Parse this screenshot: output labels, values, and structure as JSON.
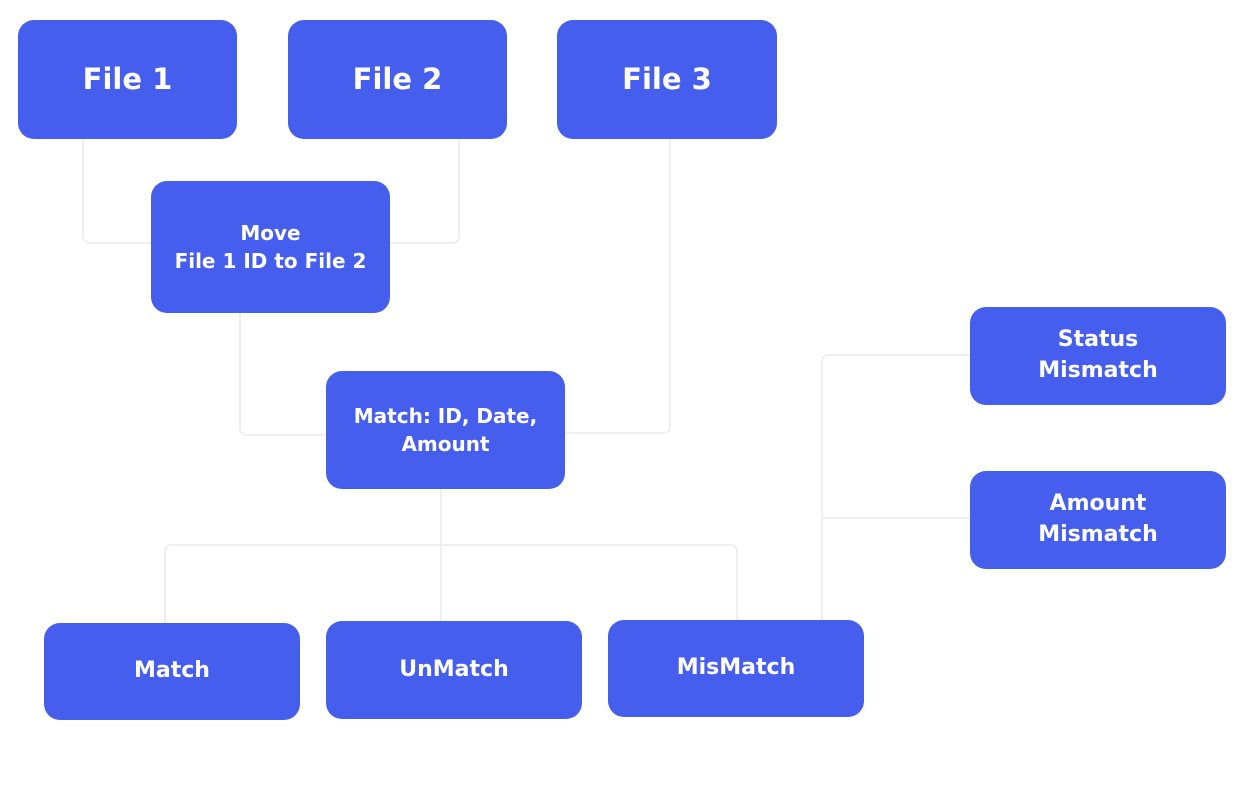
{
  "diagram": {
    "nodes": {
      "file1": "File 1",
      "file2": "File 2",
      "file3": "File 3",
      "move": "Move\nFile 1 ID to File 2",
      "match_criteria": "Match: ID, Date,\nAmount",
      "match": "Match",
      "unmatch": "UnMatch",
      "mismatch": "MisMatch",
      "status_mismatch": "Status\nMismatch",
      "amount_mismatch": "Amount\nMismatch"
    },
    "colors": {
      "node": "#465EED",
      "node_text": "#FFFFFF",
      "connector": "#F1F1F1"
    }
  }
}
